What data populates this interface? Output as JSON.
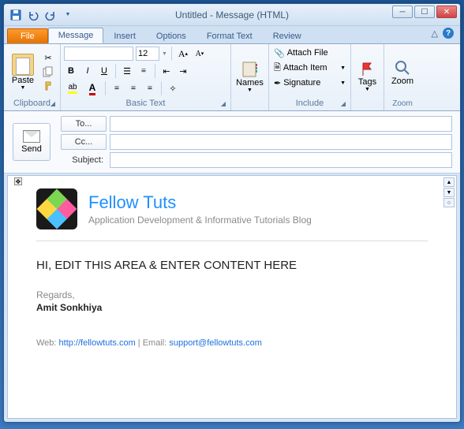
{
  "window": {
    "title": "Untitled - Message (HTML)"
  },
  "tabs": {
    "file": "File",
    "message": "Message",
    "insert": "Insert",
    "options": "Options",
    "format": "Format Text",
    "review": "Review"
  },
  "ribbon": {
    "clipboard": {
      "label": "Clipboard",
      "paste": "Paste"
    },
    "basic_text": {
      "label": "Basic Text",
      "font_size": "12"
    },
    "names": {
      "label": "Names",
      "btn": "Names"
    },
    "include": {
      "label": "Include",
      "attach_file": "Attach File",
      "attach_item": "Attach Item",
      "signature": "Signature"
    },
    "tags": {
      "label": "Tags",
      "btn": "Tags"
    },
    "zoom": {
      "label": "Zoom",
      "btn": "Zoom"
    }
  },
  "send": {
    "label": "Send",
    "to": "To...",
    "cc": "Cc...",
    "subject": "Subject:"
  },
  "email": {
    "brand": "Fellow Tuts",
    "tagline": "Application Development & Informative Tutorials Blog",
    "content": "HI, EDIT THIS AREA & ENTER CONTENT HERE",
    "regards": "Regards,",
    "signature": "Amit Sonkhiya",
    "web_label": "Web: ",
    "web_url": "http://fellowtuts.com",
    "email_label": " | Email: ",
    "email_addr": "support@fellowtuts.com"
  }
}
